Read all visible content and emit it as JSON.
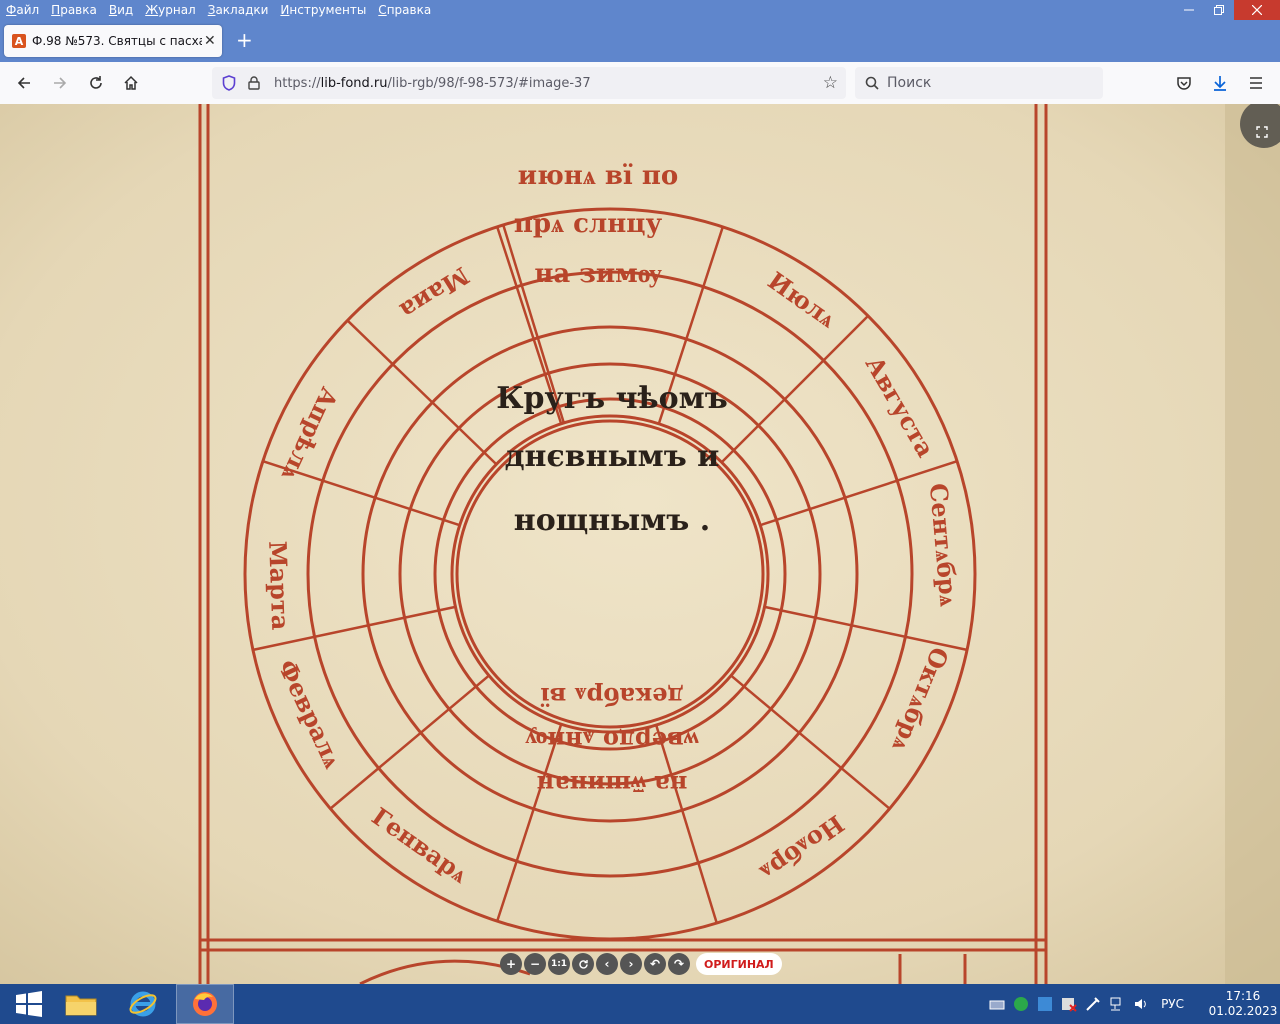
{
  "menu": [
    "Файл",
    "Правка",
    "Вид",
    "Журнал",
    "Закладки",
    "Инструменты",
    "Справка"
  ],
  "menu_underline": [
    "Ф",
    "П",
    "В",
    "Ж",
    "З",
    "И",
    "С"
  ],
  "tab": {
    "title": "Ф.98 №573. Святцы с пасхалие",
    "favicon": "А"
  },
  "url": {
    "scheme": "https://",
    "host": "lib-fond.ru",
    "path": "/lib-rgb/98/f-98-573/#image-37"
  },
  "search": {
    "placeholder": "Поиск"
  },
  "viewer": {
    "original_label": "ОРИГИНАЛ",
    "zoom_1to1": "1:1"
  },
  "manuscript": {
    "center": [
      "Кругъ чѣомъ",
      "днєвнымъ и",
      "нощнымъ ."
    ],
    "months": [
      "Марта",
      "Апрѣлѧ",
      "Маиа",
      "Июнѧ",
      "Июлѧ",
      "Августа",
      "Сентѧбрѧ",
      "Октѧбрѧ",
      "Ноѧбрѧ",
      "Декабрѧ",
      "Генварѧ",
      "Февралѧ"
    ],
    "top_segment": [
      "июнѧ вї по",
      "прѧ слнцу",
      "на зимѹ"
    ],
    "bottom_segment": [
      "на ѿшинан",
      "ѡвердо ѧннѹ",
      "декабрѧ вї"
    ]
  },
  "taskbar": {
    "lang": "РУС",
    "time": "17:16",
    "date": "01.02.2023"
  },
  "colors": {
    "chrome": "#5f86cc",
    "taskbar": "#1f4a8e",
    "ink_red": "#b8452b",
    "parchment": "#e8dcc0"
  }
}
